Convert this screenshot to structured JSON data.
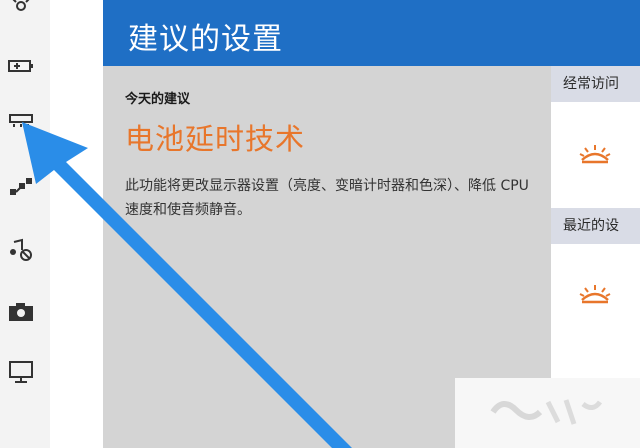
{
  "window": {
    "header_title": "建议的设置"
  },
  "sidebar": {
    "icons": [
      {
        "name": "brightness-icon"
      },
      {
        "name": "battery-icon"
      },
      {
        "name": "display-icon"
      },
      {
        "name": "network-icon"
      },
      {
        "name": "music-icon"
      },
      {
        "name": "camera-icon"
      },
      {
        "name": "monitor-icon"
      }
    ]
  },
  "main": {
    "today_label": "今天的建议",
    "tip_title": "电池延时技术",
    "tip_description": "此功能将更改显示器设置（亮度、变暗计时器和色深）、降低 CPU 速度和使音频静音。"
  },
  "right": {
    "frequent_label": "经常访问",
    "recent_label": "最近的设"
  },
  "colors": {
    "header_bg": "#1f6fc5",
    "accent_orange": "#e8762b",
    "arrow_blue": "#2a8de8"
  }
}
